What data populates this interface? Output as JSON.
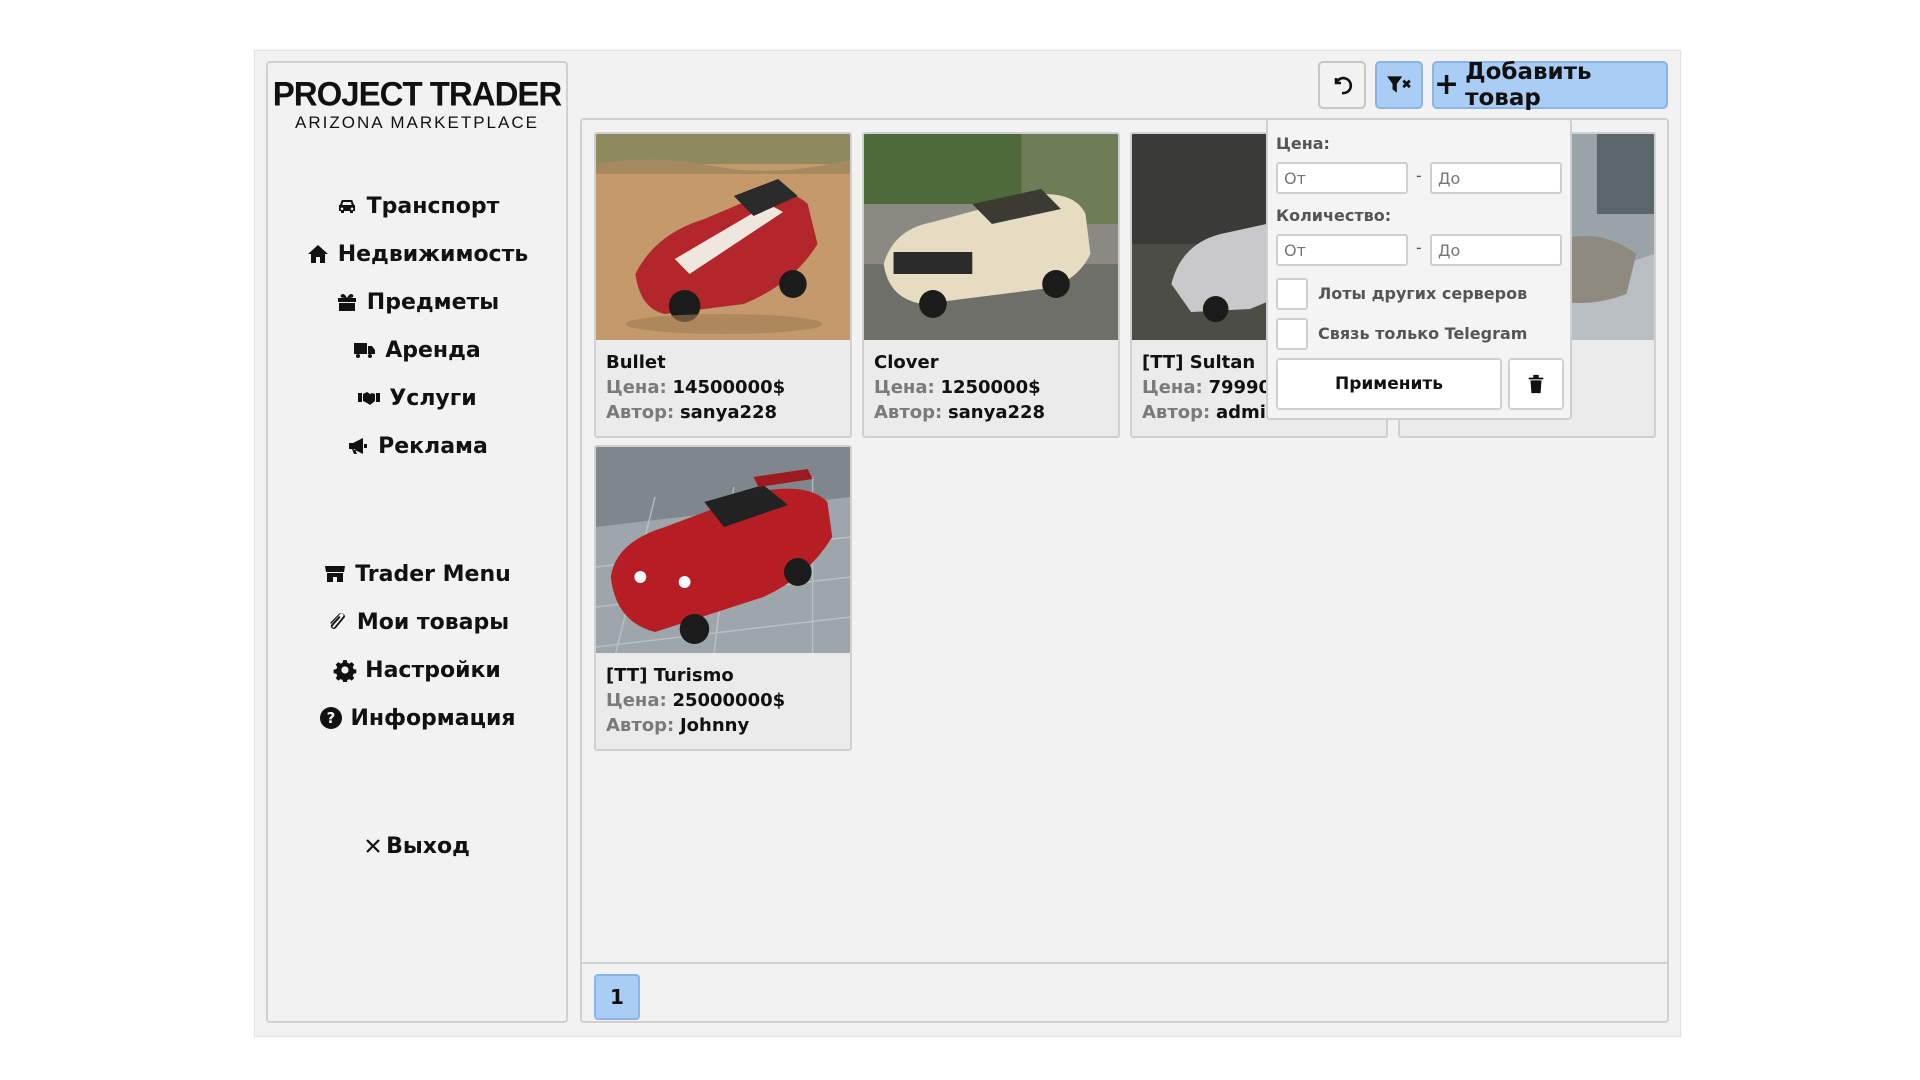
{
  "logo": {
    "title": "PROJECT TRADER",
    "subtitle": "ARIZONA  MARKETPLACE"
  },
  "sidebar": {
    "categories": [
      {
        "label": "Транспорт",
        "icon": "car-icon"
      },
      {
        "label": "Недвижимость",
        "icon": "home-icon"
      },
      {
        "label": "Предметы",
        "icon": "gift-icon"
      },
      {
        "label": "Аренда",
        "icon": "truck-icon"
      },
      {
        "label": "Услуги",
        "icon": "handshake-icon"
      },
      {
        "label": "Реклама",
        "icon": "bullhorn-icon"
      }
    ],
    "menu": [
      {
        "label": "Trader Menu",
        "icon": "store-icon"
      },
      {
        "label": "Мои товары",
        "icon": "paperclip-icon"
      },
      {
        "label": "Настройки",
        "icon": "gear-icon"
      },
      {
        "label": "Информация",
        "icon": "question-circle-icon"
      }
    ],
    "exit_label": "Выход",
    "exit_icon": "close-icon"
  },
  "toolbar": {
    "reset_icon": "undo-icon",
    "filter_icon": "filter-icon",
    "add_label": "Добавить товар",
    "add_icon": "plus-icon"
  },
  "labels": {
    "price": "Цена:",
    "author": "Автор:"
  },
  "listings": [
    {
      "name": "Bullet",
      "price": "14500000$",
      "author": "sanya228",
      "image": "red-white-sports-car-desert"
    },
    {
      "name": "Clover",
      "price": "1250000$",
      "author": "sanya228",
      "image": "cream-muscle-car-courtyard"
    },
    {
      "name": "[TT] Sultan",
      "price": "79990",
      "author": "admin",
      "image": "silver-sedan-garage"
    },
    {
      "name": "",
      "price": "$",
      "author": "",
      "image": "grey-car-tiled-floor"
    },
    {
      "name": "[TT] Turismo",
      "price": "25000000$",
      "author": "Johnny",
      "image": "red-sports-car-tiled-floor"
    }
  ],
  "filter": {
    "price_label": "Цена:",
    "quantity_label": "Количество:",
    "from_placeholder": "От",
    "to_placeholder": "До",
    "separator": "-",
    "other_servers_label": "Лоты других серверов",
    "telegram_only_label": "Связь только Telegram",
    "apply_label": "Применить",
    "delete_icon": "trash-icon"
  },
  "pagination": {
    "current_page": "1"
  },
  "colors": {
    "accent": "#a9cdf5",
    "panel": "#f2f2f2",
    "border": "#d0d0d0"
  }
}
